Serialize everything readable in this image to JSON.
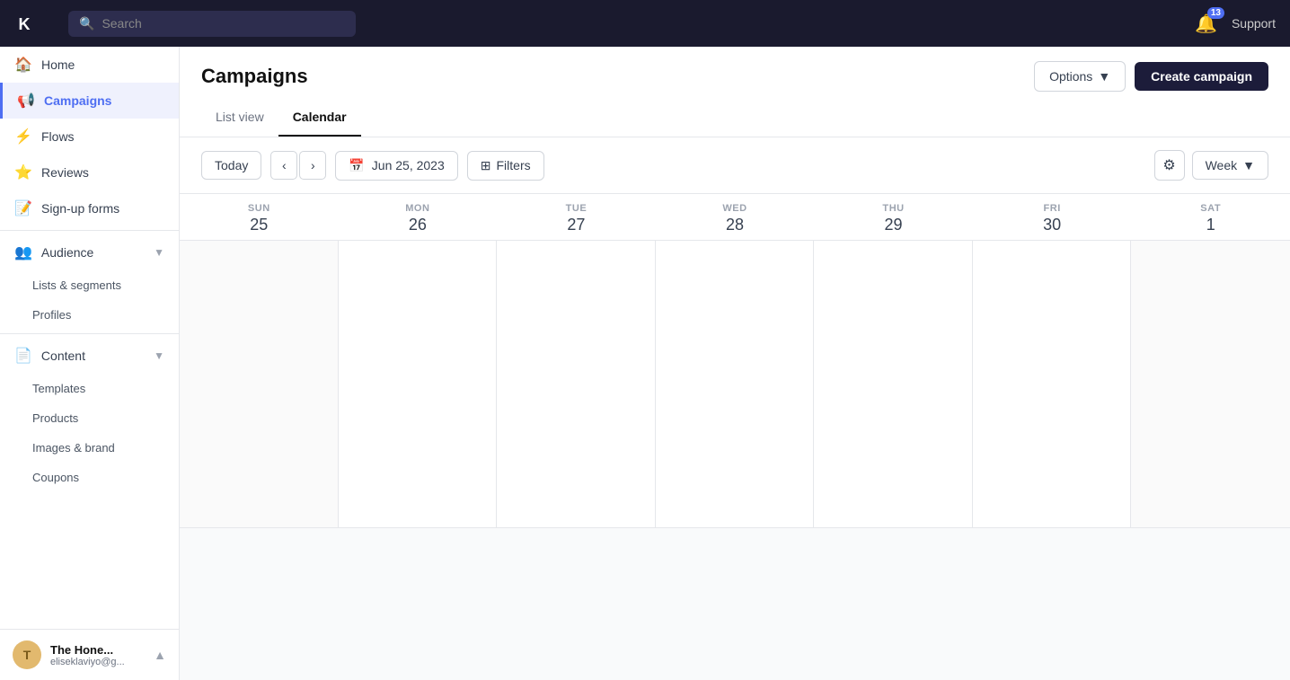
{
  "navbar": {
    "logo_alt": "Klaviyo",
    "search_placeholder": "Search",
    "notification_count": "13",
    "support_label": "Support"
  },
  "sidebar": {
    "items": [
      {
        "id": "home",
        "label": "Home",
        "icon": "🏠",
        "active": false
      },
      {
        "id": "campaigns",
        "label": "Campaigns",
        "icon": "📢",
        "active": true
      },
      {
        "id": "flows",
        "label": "Flows",
        "icon": "⚡",
        "active": false
      },
      {
        "id": "reviews",
        "label": "Reviews",
        "icon": "⭐",
        "active": false
      },
      {
        "id": "sign-up-forms",
        "label": "Sign-up forms",
        "icon": "📝",
        "active": false
      }
    ],
    "audience_section": {
      "label": "Audience",
      "icon": "👥",
      "sub_items": [
        {
          "id": "lists-segments",
          "label": "Lists & segments"
        },
        {
          "id": "profiles",
          "label": "Profiles"
        }
      ]
    },
    "content_section": {
      "label": "Content",
      "icon": "📄",
      "sub_items": [
        {
          "id": "templates",
          "label": "Templates"
        },
        {
          "id": "products",
          "label": "Products"
        },
        {
          "id": "images-brand",
          "label": "Images & brand"
        },
        {
          "id": "coupons",
          "label": "Coupons"
        }
      ]
    },
    "user": {
      "avatar_letter": "T",
      "name": "The Hone...",
      "email": "eliseklaviyo@g..."
    }
  },
  "page": {
    "title": "Campaigns",
    "options_label": "Options",
    "create_campaign_label": "Create campaign",
    "tabs": [
      {
        "id": "list-view",
        "label": "List view",
        "active": false
      },
      {
        "id": "calendar",
        "label": "Calendar",
        "active": true
      }
    ]
  },
  "calendar_toolbar": {
    "today_label": "Today",
    "prev_icon": "‹",
    "next_icon": "›",
    "date_display": "Jun 25, 2023",
    "filter_label": "Filters",
    "week_label": "Week"
  },
  "calendar": {
    "days": [
      {
        "name": "SUN",
        "num": "25",
        "weekend": true
      },
      {
        "name": "MON",
        "num": "26",
        "weekend": false
      },
      {
        "name": "TUE",
        "num": "27",
        "weekend": false
      },
      {
        "name": "WED",
        "num": "28",
        "weekend": false
      },
      {
        "name": "THU",
        "num": "29",
        "weekend": false
      },
      {
        "name": "FRI",
        "num": "30",
        "weekend": false
      },
      {
        "name": "SAT",
        "num": "1",
        "weekend": true
      }
    ]
  }
}
